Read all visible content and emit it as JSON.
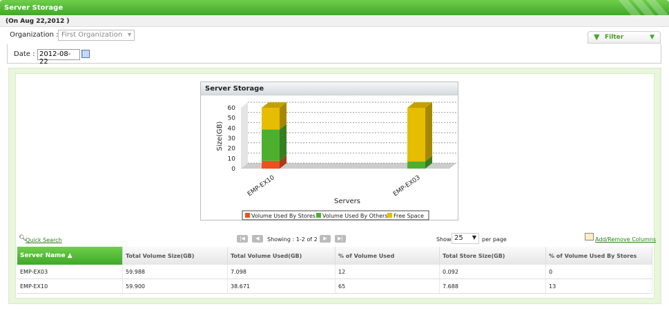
{
  "header": {
    "title": "Server Storage",
    "subtitle": "(On Aug 22,2012 )"
  },
  "filters": {
    "org_label": "Organization :",
    "org_value": "First Organization",
    "date_label": "Date :",
    "date_value": "2012-08-22",
    "filter_label": "Filter"
  },
  "chart_data": {
    "type": "bar",
    "stacked": true,
    "title": "Server Storage",
    "xlabel": "Servers",
    "ylabel": "Size(GB)",
    "ylim": [
      0,
      60
    ],
    "yticks": [
      0,
      10,
      20,
      30,
      40,
      50,
      60
    ],
    "categories": [
      "EMP-EX10",
      "EMP-EX03"
    ],
    "series": [
      {
        "name": "Volume Used By Stores",
        "color": "#e8531e",
        "values": [
          7.688,
          0.092
        ]
      },
      {
        "name": "Volume Used By Others",
        "color": "#4caf2e",
        "values": [
          30.983,
          7.006
        ]
      },
      {
        "name": "Free Space",
        "color": "#e6bd00",
        "values": [
          21.229,
          52.89
        ]
      }
    ],
    "legend": "bottom"
  },
  "toolbar": {
    "quick_search": "Quick Search",
    "showing": "Showing :  1-2 of 2",
    "show_label": "Show",
    "page_size": "25",
    "per_page": "per page",
    "columns_link": "Add/Remove Columns"
  },
  "table": {
    "headers": [
      "Server Name ▲",
      "Total Volume Size(GB)",
      "Total Volume Used(GB)",
      "% of Volume Used",
      "Total Store Size(GB)",
      "% of Volume Used By Stores"
    ],
    "rows": [
      [
        "EMP-EX03",
        "59.988",
        "7.098",
        "12",
        "0.092",
        "0"
      ],
      [
        "EMP-EX10",
        "59.900",
        "38.671",
        "65",
        "7.688",
        "13"
      ]
    ]
  }
}
